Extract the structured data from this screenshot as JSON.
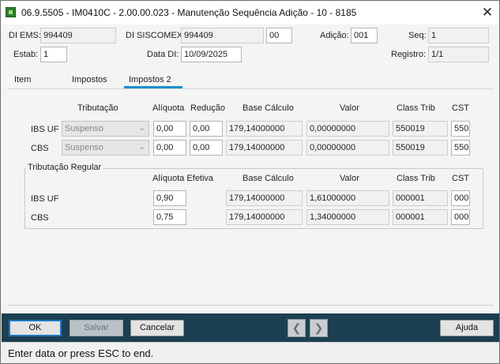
{
  "window": {
    "title": "06.9.5505 - IM0410C - 2.00.00.023 - Manutenção Sequência Adição - 10 - 8185",
    "close_glyph": "✕"
  },
  "header": {
    "di_ems_label": "DI EMS:",
    "di_ems_value": "994409",
    "di_siscomex_label": "DI SISCOMEX:",
    "di_siscomex_value": "994409",
    "di_siscomex_suffix": "00",
    "adicao_label": "Adição:",
    "adicao_value": "001",
    "seq_label": "Seq:",
    "seq_value": "1",
    "estab_label": "Estab:",
    "estab_value": "1",
    "data_di_label": "Data DI:",
    "data_di_value": "10/09/2025",
    "registro_label": "Registro:",
    "registro_value": "1/1"
  },
  "tabs": [
    {
      "label": "Item",
      "active": false
    },
    {
      "label": "Impostos",
      "active": false
    },
    {
      "label": "Impostos 2",
      "active": true
    }
  ],
  "tax_table": {
    "headers": {
      "tributacao": "Tributação",
      "aliquota": "Alíquota",
      "reducao": "Redução",
      "base_calculo": "Base Cálculo",
      "valor": "Valor",
      "class_trib": "Class Trib",
      "cst": "CST"
    },
    "rows": [
      {
        "name": "IBS UF",
        "tributacao": "Suspenso",
        "aliquota": "0,00",
        "reducao": "0,00",
        "base_calculo": "179,14000000",
        "valor": "0,00000000",
        "class_trib": "550019",
        "cst": "550"
      },
      {
        "name": "CBS",
        "tributacao": "Suspenso",
        "aliquota": "0,00",
        "reducao": "0,00",
        "base_calculo": "179,14000000",
        "valor": "0,00000000",
        "class_trib": "550019",
        "cst": "550"
      }
    ]
  },
  "regular": {
    "legend": "Tributação Regular",
    "headers": {
      "aliquota_efetiva": "Alíquota Efetiva",
      "base_calculo": "Base Cálculo",
      "valor": "Valor",
      "class_trib": "Class Trib",
      "cst": "CST"
    },
    "rows": [
      {
        "name": "IBS UF",
        "aliquota_efetiva": "0,90",
        "base_calculo": "179,14000000",
        "valor": "1,61000000",
        "class_trib": "000001",
        "cst": "000"
      },
      {
        "name": "CBS",
        "aliquota_efetiva": "0,75",
        "base_calculo": "179,14000000",
        "valor": "1,34000000",
        "class_trib": "000001",
        "cst": "000"
      }
    ]
  },
  "buttons": {
    "ok": "OK",
    "salvar": "Salvar",
    "cancelar": "Cancelar",
    "prev_glyph": "❮",
    "next_glyph": "❯",
    "ajuda": "Ajuda"
  },
  "status": {
    "text": "Enter data or press ESC to end."
  },
  "colors": {
    "tab_accent": "#1a8fd0",
    "bottom_bar": "#1c3f52",
    "ok_border": "#1a78c2"
  }
}
